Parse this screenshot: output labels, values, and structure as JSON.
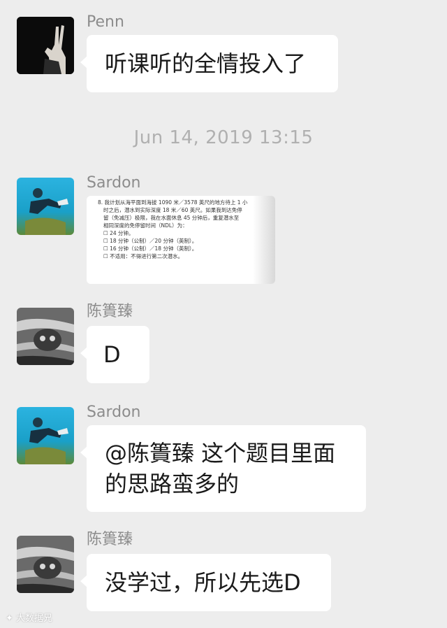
{
  "timestamp": "Jun 14, 2019 13:15",
  "messages": [
    {
      "sender": "Penn",
      "text": "听课听的全情投入了"
    },
    {
      "sender": "Sardon",
      "image_lines": [
        "8. 我计划从海平面到海拔 1090 米／3578 英尺的地方待上 1 小",
        "时之后，潜水到实际深度 18 米／60 英尺。如果我到达免停",
        "留（免减压）极限，我在水面休息 45 分钟后，重复潜水至",
        "相同深度的免停留时间（NDL）为："
      ],
      "image_options": [
        "☐ 24 分钟。",
        "☐ 18 分钟（公制）／20 分钟（英制）。",
        "☐ 16 分钟（公制）／18 分钟（英制）。",
        "☐ 不适用：不得进行第二次潜水。"
      ]
    },
    {
      "sender": "陈簣臻",
      "text": "D"
    },
    {
      "sender": "Sardon",
      "text_line1": "@陈簣臻 这个题目里面",
      "text_line2": "的思路蛮多的"
    },
    {
      "sender": "陈簣臻",
      "text": "没学过，所以先选D"
    }
  ],
  "watermark": "大数据兄",
  "icons": [
    "peace-sign-avatar-icon",
    "diver-avatar-icon",
    "cat-avatar-icon"
  ]
}
